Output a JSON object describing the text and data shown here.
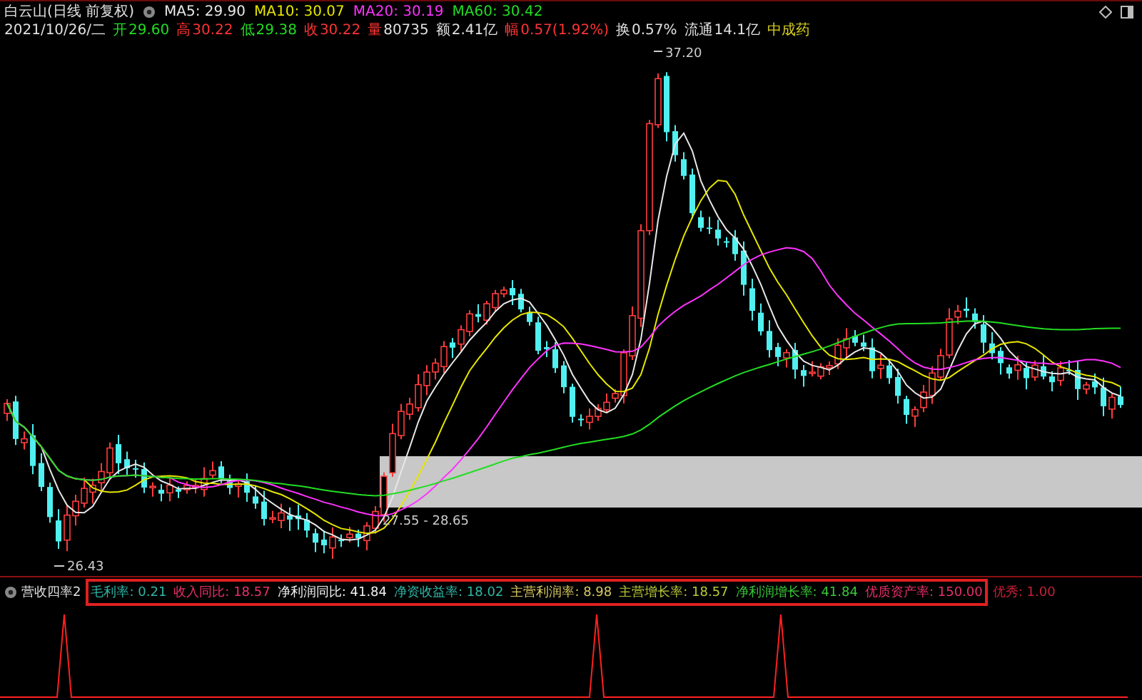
{
  "header": {
    "title": "白云山(日线 前复权)",
    "moving_averages": [
      {
        "label": "MA5:",
        "value": "29.90",
        "color": "#e8e8e8"
      },
      {
        "label": "MA10:",
        "value": "30.07",
        "color": "#e6e600"
      },
      {
        "label": "MA20:",
        "value": "30.19",
        "color": "#ff33ff"
      },
      {
        "label": "MA60:",
        "value": "30.42",
        "color": "#22dd22"
      }
    ],
    "date": "2021/10/26/二",
    "quote_fields": [
      {
        "label": {
          "text": "开",
          "color": "#22dd22"
        },
        "value": {
          "text": "29.60",
          "color": "#22dd22"
        }
      },
      {
        "label": {
          "text": "高",
          "color": "#ff3333"
        },
        "value": {
          "text": "30.22",
          "color": "#ff3333"
        }
      },
      {
        "label": {
          "text": "低",
          "color": "#22dd22"
        },
        "value": {
          "text": "29.38",
          "color": "#22dd22"
        }
      },
      {
        "label": {
          "text": "收",
          "color": "#ff3333"
        },
        "value": {
          "text": "30.22",
          "color": "#ff3333"
        }
      },
      {
        "label": {
          "text": "量",
          "color": "#ff3333"
        },
        "value": {
          "text": "80735",
          "color": "#e0e0e0"
        }
      },
      {
        "label": {
          "text": "额",
          "color": "#e0e0e0"
        },
        "value": {
          "text": "2.41亿",
          "color": "#e0e0e0"
        }
      },
      {
        "label": {
          "text": "幅",
          "color": "#ff3333"
        },
        "value": {
          "text": "0.57(1.92%)",
          "color": "#ff3333"
        }
      },
      {
        "label": {
          "text": "换",
          "color": "#e0e0e0"
        },
        "value": {
          "text": "0.57%",
          "color": "#e0e0e0"
        }
      },
      {
        "label": {
          "text": "流通",
          "color": "#e0e0e0"
        },
        "value": {
          "text": "14.1亿",
          "color": "#e0e0e0"
        }
      }
    ],
    "sector": "中成药"
  },
  "chart_labels": {
    "high": "37.20",
    "low": "26.43",
    "band_range": "27.55 - 28.65"
  },
  "indicator": {
    "name": "营收四率2",
    "items": [
      {
        "text": "毛利率: 0.21",
        "color": "#2fb8a8",
        "highlighted": true
      },
      {
        "text": "收入同比: 18.57",
        "color": "#e8306a",
        "highlighted": true
      },
      {
        "text": "净利润同比: 41.84",
        "color": "#f0f0f0",
        "highlighted": true
      },
      {
        "text": "净资收益率: 18.02",
        "color": "#2fb8a8",
        "highlighted": true
      },
      {
        "text": "主营利润率: 8.98",
        "color": "#d8c860",
        "highlighted": true
      },
      {
        "text": "主营增长率: 18.57",
        "color": "#b8c838",
        "highlighted": true
      },
      {
        "text": "净利润增长率: 41.84",
        "color": "#38c838",
        "highlighted": true
      },
      {
        "text": "优质资产率: 150.00",
        "color": "#e8306a",
        "highlighted": true
      },
      {
        "text": "优秀: 1.00",
        "color": "#c8203a",
        "highlighted": false
      }
    ]
  }
}
